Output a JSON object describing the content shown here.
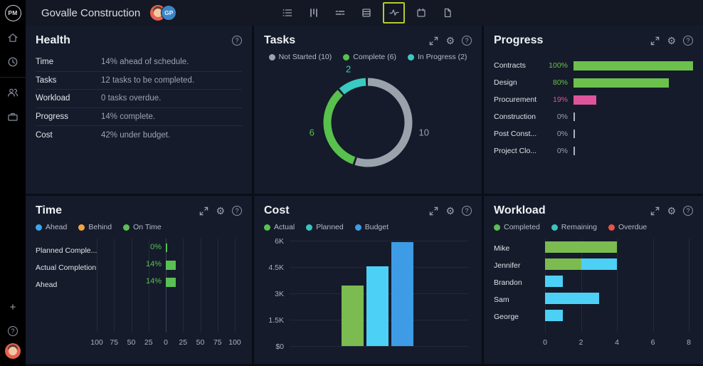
{
  "app": {
    "logo": "PM",
    "title": "Govalle Construction",
    "avatar_initials": "GP"
  },
  "ui": {
    "help_glyph": "?",
    "gear_glyph": "⚙",
    "plus_glyph": "+"
  },
  "topbar_icons": [
    "list-view",
    "board-view",
    "gantt-view",
    "sheet-view",
    "dashboard-view",
    "calendar-view",
    "docs-view"
  ],
  "topbar": {
    "active_icon": "dashboard-view",
    "highlight_color": "#b5ca33"
  },
  "sidebar_icons": [
    "home",
    "recent",
    "team",
    "portfolio",
    "add",
    "help",
    "user-avatar"
  ],
  "panels": {
    "health": {
      "title": "Health",
      "rows": [
        {
          "label": "Time",
          "value": "14% ahead of schedule."
        },
        {
          "label": "Tasks",
          "value": "12 tasks to be completed."
        },
        {
          "label": "Workload",
          "value": "0 tasks overdue."
        },
        {
          "label": "Progress",
          "value": "14% complete."
        },
        {
          "label": "Cost",
          "value": "42% under budget."
        }
      ]
    },
    "tasks": {
      "title": "Tasks"
    },
    "progress": {
      "title": "Progress"
    },
    "time": {
      "title": "Time"
    },
    "cost": {
      "title": "Cost"
    },
    "workload": {
      "title": "Workload"
    }
  },
  "chart_data": [
    {
      "id": "tasks",
      "type": "pie",
      "title": "Tasks",
      "total": 18,
      "legend": [
        {
          "label": "Not Started (10)",
          "color": "#9aa2ac"
        },
        {
          "label": "Complete (6)",
          "color": "#58c14d"
        },
        {
          "label": "In Progress (2)",
          "color": "#39cbc1"
        }
      ],
      "segments": [
        {
          "name": "Not Started",
          "value": 10,
          "color": "#9aa2ac"
        },
        {
          "name": "Complete",
          "value": 6,
          "color": "#58c14d"
        },
        {
          "name": "In Progress",
          "value": 2,
          "color": "#39cbc1"
        }
      ]
    },
    {
      "id": "progress",
      "type": "bar",
      "orientation": "horizontal",
      "title": "Progress",
      "max": 100,
      "rows": [
        {
          "label": "Contracts",
          "value": 100,
          "display": "100%",
          "color": "#6cc04c"
        },
        {
          "label": "Design",
          "value": 80,
          "display": "80%",
          "color": "#6cc04c"
        },
        {
          "label": "Procurement",
          "value": 19,
          "display": "19%",
          "color": "#de549c"
        },
        {
          "label": "Construction",
          "value": 0,
          "display": "0%",
          "color": "#98a1b0"
        },
        {
          "label": "Post Const...",
          "value": 0,
          "display": "0%",
          "color": "#98a1b0"
        },
        {
          "label": "Project Clo...",
          "value": 0,
          "display": "0%",
          "color": "#98a1b0"
        }
      ]
    },
    {
      "id": "time",
      "type": "bar",
      "orientation": "horizontal",
      "title": "Time",
      "legend": [
        {
          "label": "Ahead",
          "color": "#3aa6ef"
        },
        {
          "label": "Behind",
          "color": "#f2a440"
        },
        {
          "label": "On Time",
          "color": "#59c154"
        }
      ],
      "axis": {
        "ticks": [
          "100",
          "75",
          "50",
          "25",
          "0",
          "25",
          "50",
          "75",
          "100"
        ],
        "min": -100,
        "max": 100
      },
      "rows": [
        {
          "label": "Planned Comple...",
          "value": 0,
          "display": "0%",
          "color": "#59c154"
        },
        {
          "label": "Actual Completion",
          "value": 14,
          "display": "14%",
          "color": "#59c154"
        },
        {
          "label": "Ahead",
          "value": 14,
          "display": "14%",
          "color": "#59c154"
        }
      ]
    },
    {
      "id": "cost",
      "type": "bar",
      "title": "Cost",
      "legend": [
        {
          "label": "Actual",
          "color": "#59c154"
        },
        {
          "label": "Planned",
          "color": "#36c5bd"
        },
        {
          "label": "Budget",
          "color": "#3e9ce6"
        }
      ],
      "categories": [
        "Actual",
        "Planned",
        "Budget"
      ],
      "values": [
        3500,
        4600,
        6000
      ],
      "colors": [
        "#7cbb50",
        "#4dd0f5",
        "#3e9ce6"
      ],
      "y_ticks": [
        "$0",
        "1.5K",
        "3K",
        "4.5K",
        "6K"
      ],
      "ylim": [
        0,
        6000
      ]
    },
    {
      "id": "workload",
      "type": "bar",
      "orientation": "horizontal",
      "stacked": true,
      "title": "Workload",
      "legend": [
        {
          "label": "Completed",
          "color": "#59c154"
        },
        {
          "label": "Remaining",
          "color": "#36c5bd"
        },
        {
          "label": "Overdue",
          "color": "#e85347"
        }
      ],
      "x_ticks": [
        "0",
        "2",
        "4",
        "6",
        "8"
      ],
      "xlim": [
        0,
        8
      ],
      "rows": [
        {
          "label": "Mike",
          "segments": [
            {
              "name": "Completed",
              "value": 4,
              "color": "#7cbb50"
            }
          ]
        },
        {
          "label": "Jennifer",
          "segments": [
            {
              "name": "Completed",
              "value": 2,
              "color": "#7cbb50"
            },
            {
              "name": "Remaining",
              "value": 2,
              "color": "#4dd0f5"
            }
          ]
        },
        {
          "label": "Brandon",
          "segments": [
            {
              "name": "Remaining",
              "value": 1,
              "color": "#4dd0f5"
            }
          ]
        },
        {
          "label": "Sam",
          "segments": [
            {
              "name": "Remaining",
              "value": 3,
              "color": "#4dd0f5"
            }
          ]
        },
        {
          "label": "George",
          "segments": [
            {
              "name": "Remaining",
              "value": 1,
              "color": "#4dd0f5"
            }
          ]
        }
      ]
    }
  ]
}
